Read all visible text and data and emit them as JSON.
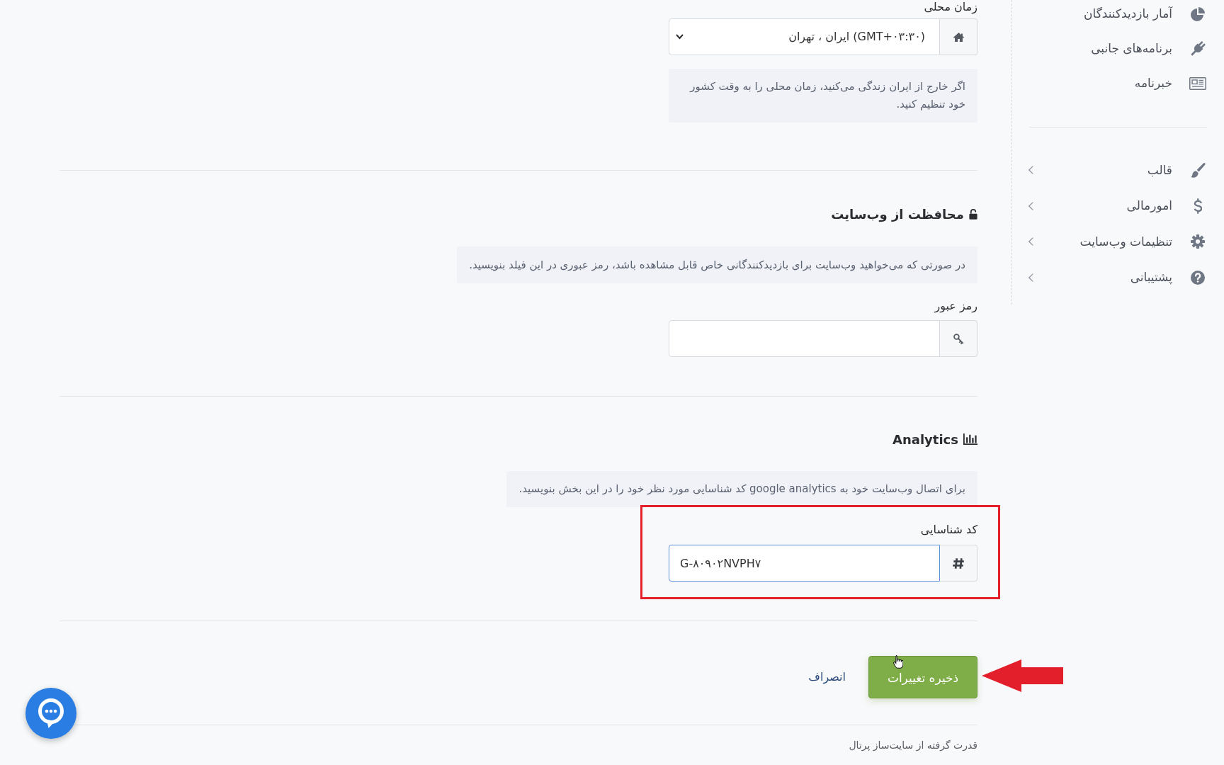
{
  "sidebar": {
    "groups": [
      {
        "items": [
          {
            "label": "آمار بازدیدکنندگان"
          },
          {
            "label": "برنامه‌های جانبی"
          },
          {
            "label": "خبرنامه"
          }
        ]
      },
      {
        "items": [
          {
            "label": "قالب",
            "expanded": false
          },
          {
            "label": "امورمالی",
            "expanded": false
          },
          {
            "label": "تنظیمات وب‌سایت",
            "expanded": false
          },
          {
            "label": "پشتیبانی",
            "expanded": false
          }
        ]
      }
    ]
  },
  "timezone": {
    "label": "زمان محلی",
    "value": "(GMT+۰۳:۳۰) ایران ، تهران",
    "note": "اگر خارج از ایران زندگی می‌کنید، زمان محلی را به وقت کشور خود تنظیم کنید."
  },
  "protection": {
    "title": "محافظت از وب‌سایت",
    "note": "در صورتی که می‌خواهید وب‌سایت برای بازدیدکنندگانی خاص قابل مشاهده باشد، رمز عبوری در این فیلد بنویسید.",
    "field": {
      "label": "رمز عبور",
      "focused": false
    }
  },
  "analytics": {
    "title": "Analytics",
    "note": "برای اتصال وب‌سایت خود به google analytics کد شناسایی مورد نظر خود را در این بخش بنویسید.",
    "field": {
      "label": "کد شناسایی",
      "value": "G-۸۰۹۰۲NVPH۷",
      "focused": true
    }
  },
  "actions": {
    "save": "ذخیره تغییرات",
    "cancel": "انصراف"
  },
  "footer": "قدرت گرفته از سایت‌ساز پرتال"
}
